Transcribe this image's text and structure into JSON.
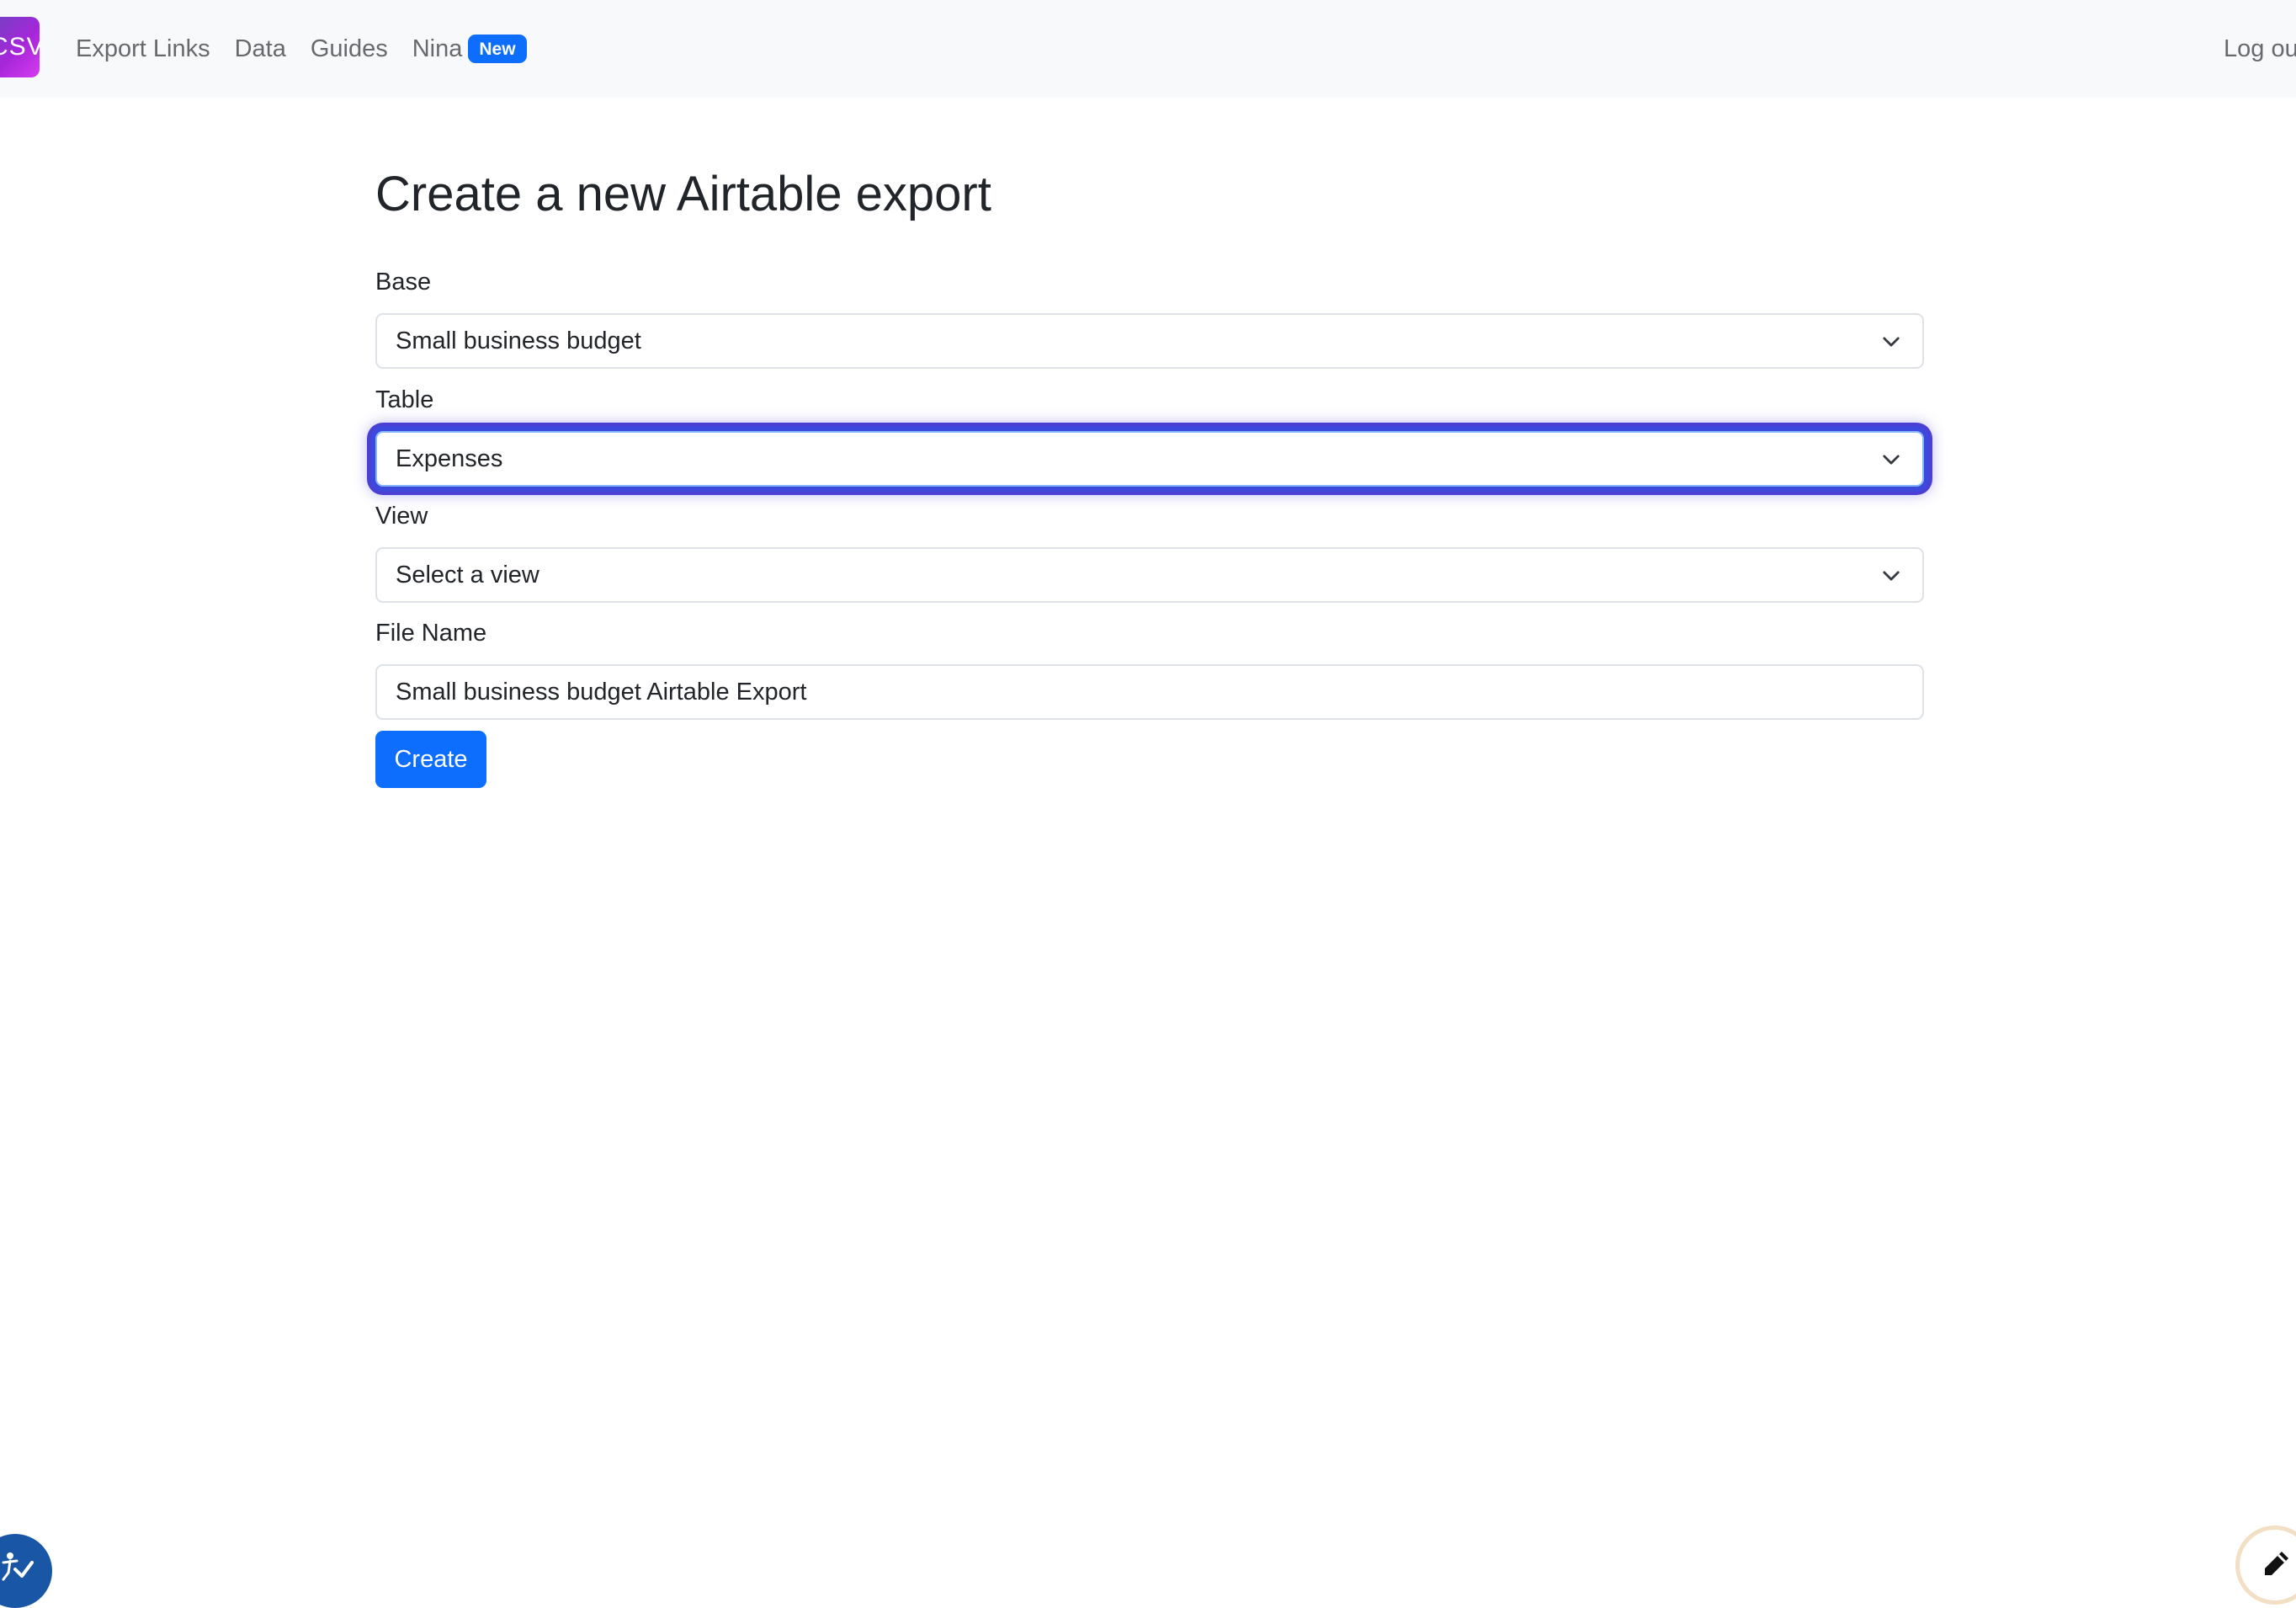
{
  "navbar": {
    "brand_text": "CSV",
    "links": {
      "export_links": "Export Links",
      "data": "Data",
      "guides": "Guides",
      "nina": "Nina"
    },
    "badge": "New",
    "logout": "Log out"
  },
  "page": {
    "title": "Create a new Airtable export"
  },
  "form": {
    "base": {
      "label": "Base",
      "value": "Small business budget"
    },
    "table": {
      "label": "Table",
      "value": "Expenses"
    },
    "view": {
      "label": "View",
      "value": "Select a view"
    },
    "file_name": {
      "label": "File Name",
      "value": "Small business budget Airtable Export"
    },
    "submit_label": "Create"
  },
  "colors": {
    "primary": "#0d6efd",
    "navbar_bg": "#f8f9fa",
    "focus_ring": "#4b3fd4",
    "brand_gradient_start": "#6f42c1",
    "brand_gradient_end": "#d63cf0"
  },
  "icons": {
    "select_chevron": "chevron-down-icon",
    "accessibility_widget": "accessibility-icon",
    "feedback_widget": "pencil-icon"
  }
}
